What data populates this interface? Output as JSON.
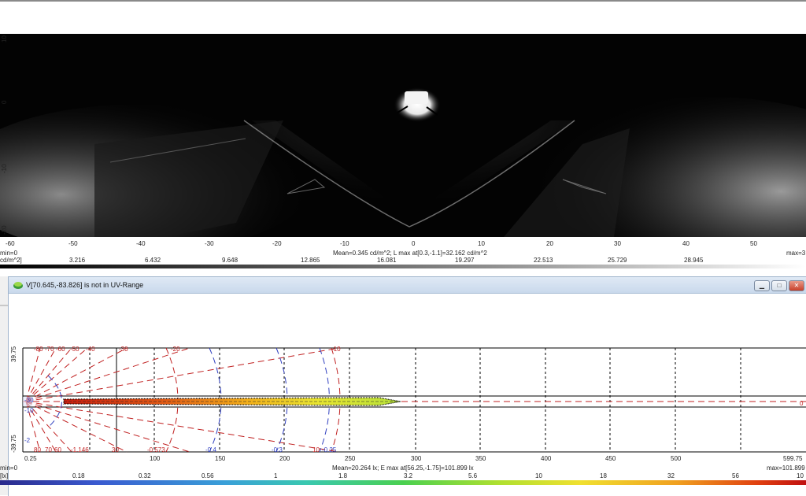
{
  "top_view": {
    "y_ticks": [
      "10",
      "0",
      "-10",
      "-20"
    ],
    "x_ticks": [
      "-60",
      "-50",
      "-40",
      "-30",
      "-20",
      "-10",
      "0",
      "10",
      "20",
      "30",
      "40",
      "50"
    ],
    "min_label": "min=0",
    "max_label": "max=3",
    "stats": "Mean=0.345 cd/m^2; L max at[0.3,-1.1]=32.162 cd/m^2",
    "unit": "cd/m^2]",
    "scale_values": [
      "3.216",
      "6.432",
      "9.648",
      "12.865",
      "16.081",
      "19.297",
      "22.513",
      "25.729",
      "28.945"
    ]
  },
  "bottom_window": {
    "title": "V[70.645,-83.826] is not in UV-Range",
    "y_ticks": [
      "39.75",
      "-39.75"
    ],
    "x_ticks": [
      "0.25",
      "100",
      "150",
      "200",
      "250",
      "300",
      "350",
      "400",
      "450",
      "500",
      "599.75"
    ],
    "contour_labels_top": [
      "-80",
      "-70",
      "-60",
      "-50",
      "-40",
      "-30",
      "-20",
      "-10"
    ],
    "contour_labels_bottom": [
      "80",
      "70",
      "60",
      "30",
      "-1.146",
      "-0.573",
      "-0.4",
      "-0.3",
      "10",
      "-0.25"
    ],
    "contour_labels_left": [
      "-30",
      "-10",
      "-2"
    ],
    "right_marker": "0",
    "min_label": "min=0",
    "max_label": "max=101.899",
    "stats": "Mean=20.264 lx; E max at[56.25,-1.75]=101.899 lx",
    "unit": "[lx]",
    "scale_values": [
      "0.18",
      "0.32",
      "0.56",
      "1",
      "1.8",
      "3.2",
      "5.6",
      "10",
      "18",
      "32",
      "56",
      "10"
    ],
    "colors": {
      "dim_line": "#c02020",
      "blue_arc": "#3040c0",
      "beam": [
        "#c81e10",
        "#f29a1a",
        "#e8e430",
        "#b6e23a"
      ]
    }
  }
}
